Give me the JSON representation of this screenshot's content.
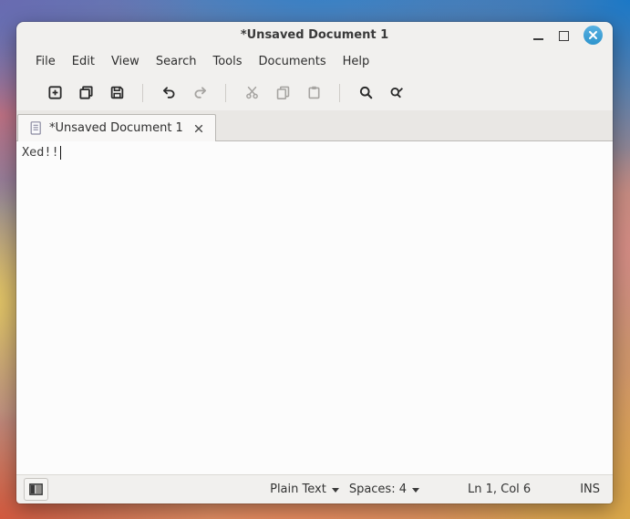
{
  "window": {
    "title": "*Unsaved Document 1"
  },
  "menubar": {
    "items": [
      {
        "label": "File"
      },
      {
        "label": "Edit"
      },
      {
        "label": "View"
      },
      {
        "label": "Search"
      },
      {
        "label": "Tools"
      },
      {
        "label": "Documents"
      },
      {
        "label": "Help"
      }
    ]
  },
  "toolbar": {
    "buttons": [
      {
        "icon": "new-document-icon",
        "enabled": true
      },
      {
        "icon": "open-document-icon",
        "enabled": true
      },
      {
        "icon": "save-icon",
        "enabled": true
      },
      {
        "icon": "undo-icon",
        "enabled": true
      },
      {
        "icon": "redo-icon",
        "enabled": false
      },
      {
        "icon": "cut-icon",
        "enabled": false
      },
      {
        "icon": "copy-icon",
        "enabled": false
      },
      {
        "icon": "paste-icon",
        "enabled": false
      },
      {
        "icon": "find-icon",
        "enabled": true
      },
      {
        "icon": "find-replace-icon",
        "enabled": true
      }
    ]
  },
  "tabbar": {
    "tabs": [
      {
        "label": "*Unsaved Document 1",
        "active": true,
        "modified": true
      }
    ]
  },
  "editor": {
    "lines": [
      "Xed!!"
    ]
  },
  "statusbar": {
    "language": "Plain Text",
    "tab_width": "Spaces: 4",
    "position": "Ln 1, Col 6",
    "input_mode": "INS"
  },
  "colors": {
    "close_button": "#38a1d6",
    "window_bg": "#f1f0ee",
    "editor_bg": "#fcfcfc",
    "titlebar_text": "#3a3a3a"
  }
}
